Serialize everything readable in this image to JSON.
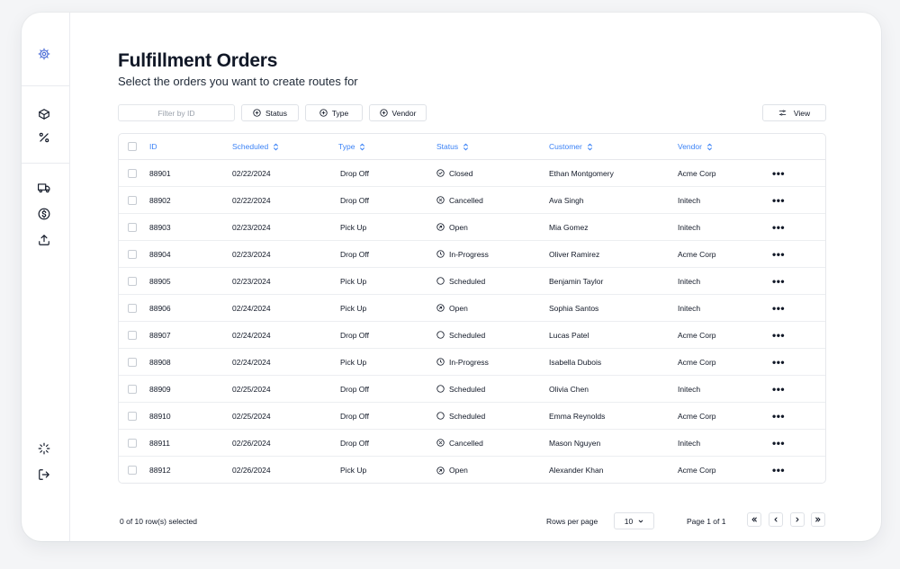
{
  "page": {
    "title": "Fulfillment Orders",
    "subtitle": "Select the orders you want to create routes for"
  },
  "toolbar": {
    "filter_placeholder": "Filter by ID",
    "status_label": "Status",
    "type_label": "Type",
    "vendor_label": "Vendor",
    "view_label": "View"
  },
  "table": {
    "columns": [
      "ID",
      "Scheduled",
      "Type",
      "Status",
      "Customer",
      "Vendor"
    ],
    "rows": [
      {
        "id": "88901",
        "scheduled": "02/22/2024",
        "type": "Drop Off",
        "status": "Closed",
        "status_icon": "check-circle-icon",
        "customer": "Ethan Montgomery",
        "vendor": "Acme Corp"
      },
      {
        "id": "88902",
        "scheduled": "02/22/2024",
        "type": "Drop Off",
        "status": "Cancelled",
        "status_icon": "x-circle-icon",
        "customer": "Ava Singh",
        "vendor": "Initech"
      },
      {
        "id": "88903",
        "scheduled": "02/23/2024",
        "type": "Pick Up",
        "status": "Open",
        "status_icon": "arrow-circle-icon",
        "customer": "Mia Gomez",
        "vendor": "Initech"
      },
      {
        "id": "88904",
        "scheduled": "02/23/2024",
        "type": "Drop Off",
        "status": "In-Progress",
        "status_icon": "clock-icon",
        "customer": "Oliver Ramirez",
        "vendor": "Acme Corp"
      },
      {
        "id": "88905",
        "scheduled": "02/23/2024",
        "type": "Pick Up",
        "status": "Scheduled",
        "status_icon": "circle-icon",
        "customer": "Benjamin Taylor",
        "vendor": "Initech"
      },
      {
        "id": "88906",
        "scheduled": "02/24/2024",
        "type": "Pick Up",
        "status": "Open",
        "status_icon": "arrow-circle-icon",
        "customer": "Sophia Santos",
        "vendor": "Initech"
      },
      {
        "id": "88907",
        "scheduled": "02/24/2024",
        "type": "Drop Off",
        "status": "Scheduled",
        "status_icon": "circle-icon",
        "customer": "Lucas Patel",
        "vendor": "Acme Corp"
      },
      {
        "id": "88908",
        "scheduled": "02/24/2024",
        "type": "Pick Up",
        "status": "In-Progress",
        "status_icon": "clock-icon",
        "customer": "Isabella Dubois",
        "vendor": "Acme Corp"
      },
      {
        "id": "88909",
        "scheduled": "02/25/2024",
        "type": "Drop Off",
        "status": "Scheduled",
        "status_icon": "circle-icon",
        "customer": "Olivia Chen",
        "vendor": "Initech"
      },
      {
        "id": "88910",
        "scheduled": "02/25/2024",
        "type": "Drop Off",
        "status": "Scheduled",
        "status_icon": "circle-icon",
        "customer": "Emma Reynolds",
        "vendor": "Acme Corp"
      },
      {
        "id": "88911",
        "scheduled": "02/26/2024",
        "type": "Drop Off",
        "status": "Cancelled",
        "status_icon": "x-circle-icon",
        "customer": "Mason Nguyen",
        "vendor": "Initech"
      },
      {
        "id": "88912",
        "scheduled": "02/26/2024",
        "type": "Pick Up",
        "status": "Open",
        "status_icon": "arrow-circle-icon",
        "customer": "Alexander Khan",
        "vendor": "Acme Corp"
      }
    ],
    "row_action_label": "•••"
  },
  "footer": {
    "selection": "0 of 10 row(s) selected",
    "rows_per_page_label": "Rows per page",
    "rows_per_page_value": "10",
    "page_info": "Page 1 of 1"
  },
  "sidebar": {
    "icons": [
      "gear-cluster-icon",
      "box-icon",
      "percent-icon",
      "truck-icon",
      "dollar-icon",
      "upload-icon",
      "loader-icon",
      "logout-icon"
    ]
  },
  "colors": {
    "accent": "#3b82f6",
    "logo": "#4f6fd8",
    "text": "#111827",
    "border": "#e6e8ec"
  }
}
